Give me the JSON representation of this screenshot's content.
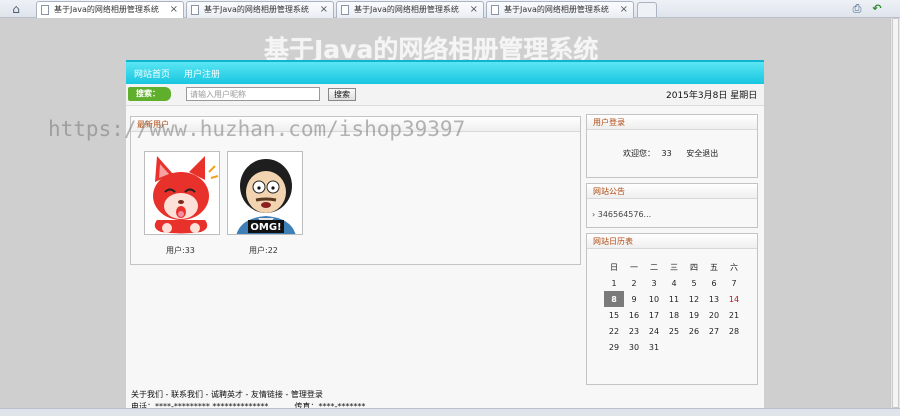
{
  "browser": {
    "tabs": [
      {
        "title": "基于Java的网络相册管理系统"
      },
      {
        "title": "基于Java的网络相册管理系统"
      },
      {
        "title": "基于Java的网络相册管理系统"
      },
      {
        "title": "基于Java的网络相册管理系统"
      }
    ],
    "close_glyph": "×"
  },
  "site": {
    "title": "基于Java的网络相册管理系统",
    "nav": [
      "网站首页",
      "用户注册"
    ],
    "search": {
      "label": "搜索：",
      "placeholder": "请输入用户昵称",
      "button": "搜索"
    },
    "date": "2015年3月8日 星期日"
  },
  "newest_users": {
    "title": "最新用户",
    "users": [
      {
        "caption": "用户:33",
        "avatar": "red-fox-avatar"
      },
      {
        "caption": "用户:22",
        "avatar": "cartoon-man-omg-avatar",
        "image_text": "OMG!"
      }
    ]
  },
  "login": {
    "title": "用户登录",
    "welcome": "欢迎您：",
    "user": "33",
    "logout": "安全退出"
  },
  "announcement": {
    "title": "网站公告",
    "items": [
      "346564576..."
    ]
  },
  "calendar": {
    "title": "网站日历表",
    "weekdays": [
      "日",
      "一",
      "二",
      "三",
      "四",
      "五",
      "六"
    ],
    "weeks": [
      [
        "1",
        "2",
        "3",
        "4",
        "5",
        "6",
        "7"
      ],
      [
        "8",
        "9",
        "10",
        "11",
        "12",
        "13",
        "14"
      ],
      [
        "15",
        "16",
        "17",
        "18",
        "19",
        "20",
        "21"
      ],
      [
        "22",
        "23",
        "24",
        "25",
        "26",
        "27",
        "28"
      ],
      [
        "29",
        "30",
        "31",
        "",
        "",
        "",
        ""
      ]
    ],
    "today": "8"
  },
  "footer": {
    "links": "关于我们 - 联系我们 - 诚聘英才 - 友情链接 - 管理登录",
    "phone_label": "电话：",
    "phone": "****-********* **************",
    "fax_label": "传真：",
    "fax": "****-*******"
  },
  "watermark": "https://www.huzhan.com/ishop39397"
}
